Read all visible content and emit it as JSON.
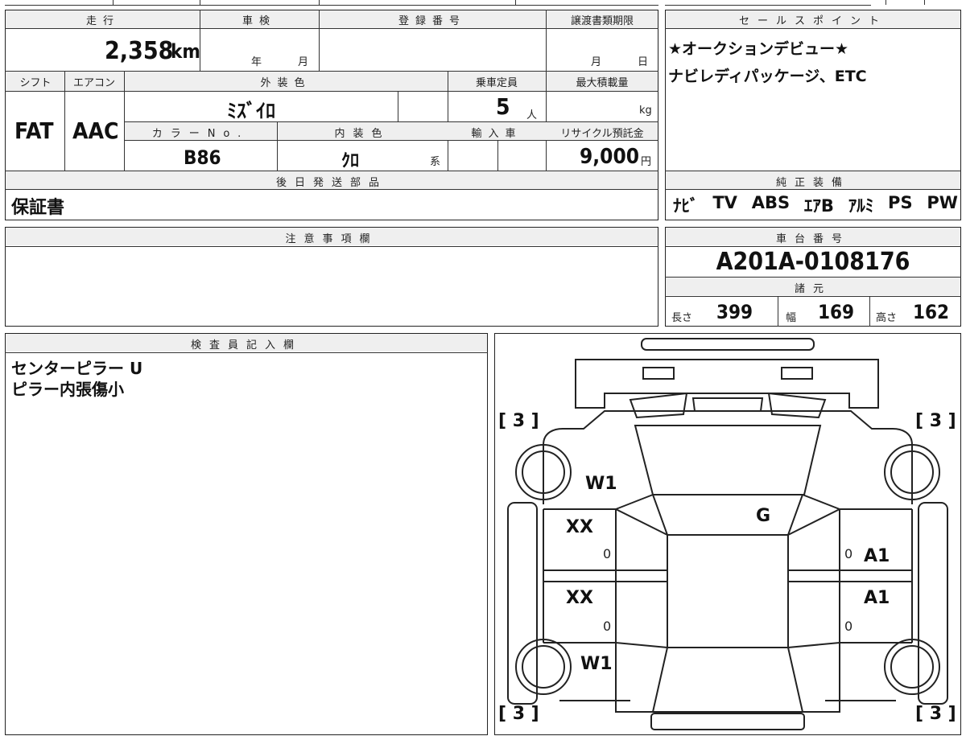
{
  "sheet": {
    "headers": {
      "mileage": "走行",
      "inspection": "車検",
      "registration": "登録番号",
      "transfer_deadline": "譲渡書類期限",
      "shift": "シフト",
      "aircon": "エアコン",
      "exterior_color": "外装色",
      "capacity": "乗車定員",
      "max_load": "最大積載量",
      "color_no": "カラーNo.",
      "interior_color": "内装色",
      "import": "輸入車",
      "recycle": "リサイクル預託金",
      "later_parts": "後日発送部品",
      "notes": "注意事項欄",
      "inspector": "検査員記入欄",
      "sales_point": "セールスポイント",
      "genuine_equipment": "純正装備",
      "chassis_no": "車台番号",
      "specs": "諸元"
    },
    "mileage_value": "2,358",
    "mileage_unit": "km",
    "year_label": "年",
    "month_label": "月",
    "deadline_month": "月",
    "deadline_day": "日",
    "shift_value": "FAT",
    "aircon_value": "AAC",
    "exterior_color_value": "ﾐｽﾞｲﾛ",
    "capacity_value": "5",
    "capacity_unit": "人",
    "load_unit": "kg",
    "color_no_value": "B86",
    "interior_color_value": "ｸﾛ",
    "interior_suffix": "系",
    "recycle_value": "9,000",
    "recycle_unit": "円",
    "later_parts_value": "保証書",
    "sales_point_lines": [
      "★オークションデビュー★",
      "ナビレディパッケージ、ETC"
    ],
    "equipment": [
      "ﾅﾋﾞ",
      "TV",
      "ABS",
      "ｴｱB",
      "ｱﾙﾐ",
      "PS",
      "PW"
    ],
    "chassis_value": "A201A-0108176",
    "spec_length_label": "長さ",
    "spec_length": "399",
    "spec_width_label": "幅",
    "spec_width": "169",
    "spec_height_label": "高さ",
    "spec_height": "162",
    "inspector_lines": [
      "センターピラー U",
      "ピラー内張傷小"
    ]
  },
  "diagram": {
    "tire_tl": "[ 3 ]",
    "tire_tr": "[ 3 ]",
    "tire_bl": "[ 3 ]",
    "tire_br": "[ 3 ]",
    "w1_top": "W1",
    "w1_bottom": "W1",
    "glass_g": "G",
    "xx_front": "XX",
    "xx_rear": "XX",
    "a1_front": "A1",
    "a1_rear": "A1",
    "zero_1": "0",
    "zero_2": "0",
    "zero_3": "0",
    "zero_4": "0"
  }
}
